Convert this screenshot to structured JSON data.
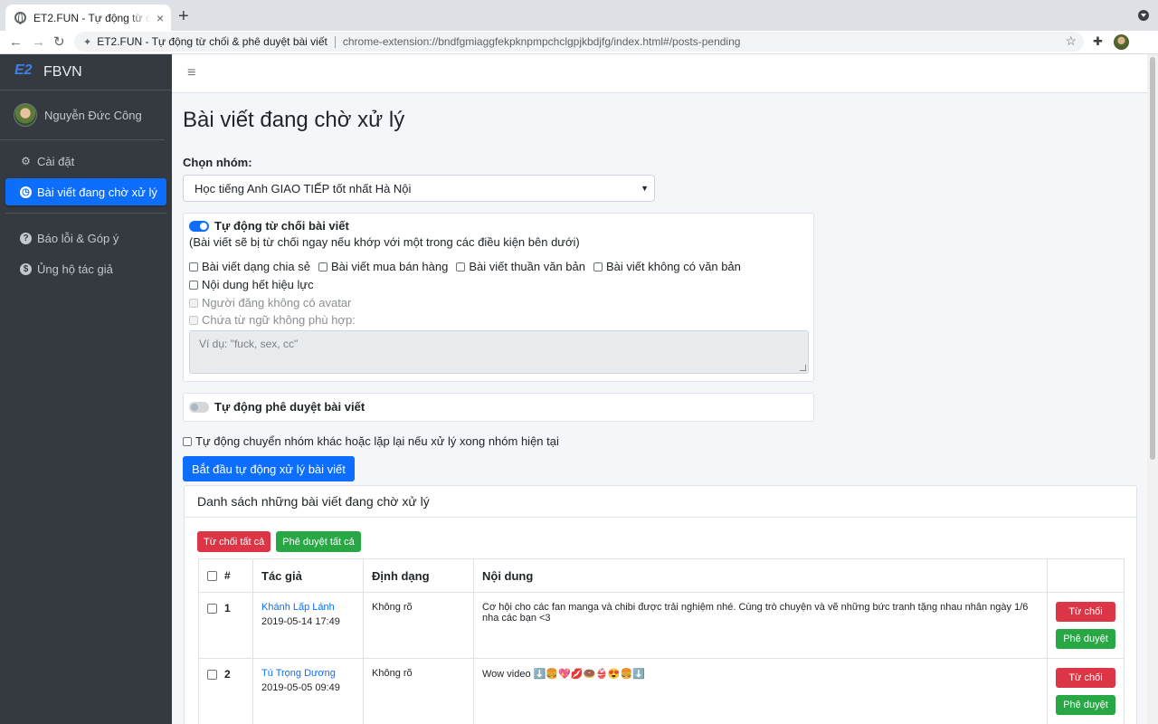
{
  "browser": {
    "tab_title": "ET2.FUN - Tự động từ chối & phê duyệt bài viết",
    "tab_close": "×",
    "new_tab": "+",
    "omnibox_title": "ET2.FUN - Tự động từ chối & phê duyệt bài viết",
    "omnibox_url": "chrome-extension://bndfgmiaggfekpknpmpchclgpjkbdjfg/index.html#/posts-pending",
    "back": "←",
    "forward": "→",
    "reload": "↻",
    "star": "☆",
    "extension_icon": "puzzle-icon",
    "kebab": "⋮"
  },
  "sidebar": {
    "brand": "FBVN",
    "logo_glyph": "E2",
    "user_name": "Nguyễn Đức Công",
    "items": [
      {
        "label": "Cài đặt",
        "icon": "gear-icon",
        "glyph": "⚙",
        "active": false
      },
      {
        "label": "Bài viết đang chờ xử lý",
        "icon": "clock-icon",
        "glyph": "◷",
        "active": true
      },
      {
        "label": "Báo lỗi & Góp ý",
        "icon": "question-icon",
        "glyph": "?",
        "active": false
      },
      {
        "label": "Ủng hộ tác giả",
        "icon": "donate-icon",
        "glyph": "$",
        "active": false
      }
    ]
  },
  "main": {
    "menu_glyph": "≡",
    "page_title": "Bài viết đang chờ xử lý",
    "group_label": "Chọn nhóm:",
    "group_selected": "Học tiếng Anh GIAO TIẾP tốt nhất Hà Nội",
    "auto_reject": {
      "label": "Tự động từ chối bài viết",
      "enabled": true,
      "hint": "(Bài viết sẽ bị từ chối ngay nếu khớp với một trong các điều kiện bên dưới)",
      "options_row1": [
        "Bài viết dạng chia sẻ",
        "Bài viết mua bán hàng",
        "Bài viết thuần văn bản",
        "Bài viết không có văn bản"
      ],
      "option_expired": "Nội dung hết hiệu lực",
      "option_no_avatar": "Người đăng không có avatar",
      "option_bad_words": "Chứa từ ngữ không phù hợp:",
      "bad_words_placeholder": "Ví dụ: \"fuck, sex, cc\""
    },
    "auto_approve": {
      "label": "Tự động phê duyệt bài viết",
      "enabled": false
    },
    "auto_switch_label": "Tự động chuyển nhóm khác hoặc lặp lại nếu xử lý xong nhóm hiện tại",
    "start_button": "Bắt đầu tự động xử lý bài viết",
    "list": {
      "title": "Danh sách những bài viết đang chờ xử lý",
      "reject_all": "Từ chối tất cả",
      "approve_all": "Phê duyệt tất cả",
      "columns": [
        "#",
        "Tác giả",
        "Định dạng",
        "Nội dung",
        ""
      ],
      "reject_label": "Từ chối",
      "approve_label": "Phê duyệt",
      "rows": [
        {
          "num": "1",
          "author": "Khánh Lấp Lánh",
          "time": "2019-05-14 17:49",
          "format": "Không rõ",
          "content": "Cơ hội cho các fan manga và chibi được trải nghiệm nhé. Cùng trò chuyện và vẽ những bức tranh tặng nhau nhân ngày 1/6 nha các bạn <3"
        },
        {
          "num": "2",
          "author": "Tú Trọng Dương",
          "time": "2019-05-05 09:49",
          "format": "Không rõ",
          "content": "Wow video ⬇️🍔💖💋🍩👙😍🍔⬇️"
        }
      ]
    }
  },
  "colors": {
    "sidebar_bg": "#343a40",
    "primary": "#0d6efd",
    "danger": "#dc3545",
    "success": "#28a745",
    "content_bg": "#f4f6f9"
  }
}
